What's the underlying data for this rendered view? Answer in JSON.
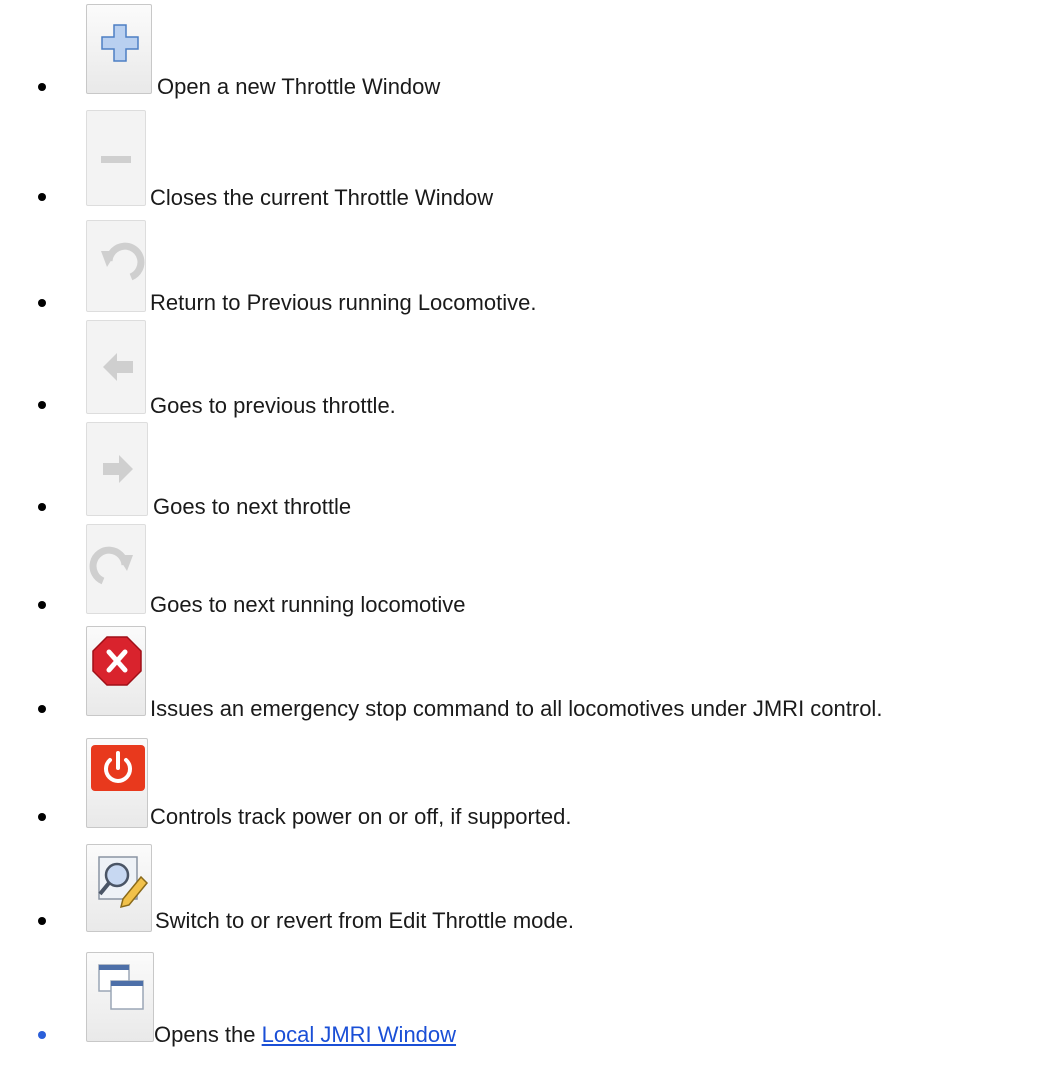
{
  "items": [
    {
      "icon": "plus-icon",
      "text": "Open a new Throttle Window"
    },
    {
      "icon": "minus-icon",
      "text": "Closes the current Throttle Window"
    },
    {
      "icon": "undo-arrow-icon",
      "text": "Return to Previous running Locomotive."
    },
    {
      "icon": "left-arrow-icon",
      "text": "Goes to previous throttle."
    },
    {
      "icon": "right-arrow-icon",
      "text": "Goes to next throttle"
    },
    {
      "icon": "redo-arrow-icon",
      "text": "Goes to next running locomotive"
    },
    {
      "icon": "emergency-stop-icon",
      "text": "Issues an emergency stop command to all locomotives under JMRI control."
    },
    {
      "icon": "power-icon",
      "text": "Controls track power on or off, if supported."
    },
    {
      "icon": "edit-throttle-icon",
      "text": "Switch to or revert from Edit Throttle mode."
    },
    {
      "icon": "windows-icon",
      "prefix": "Opens the ",
      "link_text": "Local JMRI Window"
    }
  ],
  "colors": {
    "link": "#1a4fd6",
    "plus_icon": "#8fb2e0",
    "emergency_stop": "#d9232d",
    "power": "#e8391d"
  }
}
